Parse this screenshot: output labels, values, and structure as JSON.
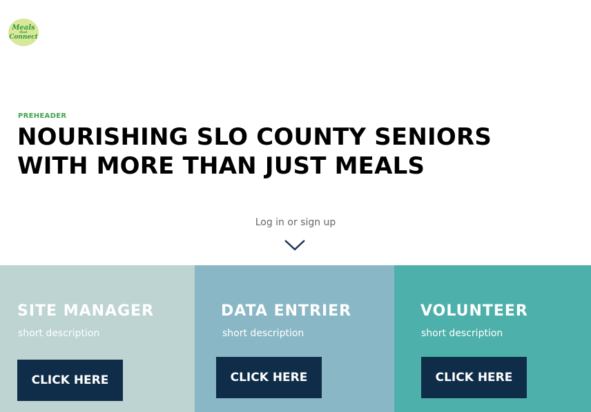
{
  "logo": {
    "line1": "Meals",
    "line2": "that",
    "line3": "Connect"
  },
  "hero": {
    "preheader": "PREHEADER",
    "title_line1": "NOURISHING SLO COUNTY SENIORS",
    "title_line2": "WITH MORE THAN JUST MEALS",
    "login_text": "Log in or sign up",
    "chevron_icon": "chevron-down-icon"
  },
  "panels": [
    {
      "title": "SITE MANAGER",
      "description": "short description",
      "button": "CLICK HERE",
      "color": "#BDD4D2"
    },
    {
      "title": "DATA ENTRIER",
      "description": "short description",
      "button": "CLICK HERE",
      "color": "#89B7C5"
    },
    {
      "title": "VOLUNTEER",
      "description": "short description",
      "button": "CLICK HERE",
      "color": "#4DB0AB"
    }
  ],
  "colors": {
    "button": "#0F2D48",
    "accent": "#3FA34D"
  }
}
